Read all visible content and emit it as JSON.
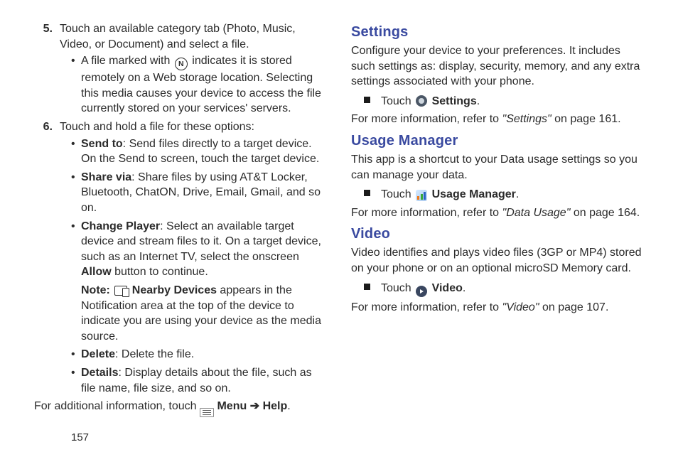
{
  "left": {
    "step5_num": "5.",
    "step5": "Touch an available category tab (Photo, Music, Video, or Document) and select a file.",
    "step5_sub_pre": "A file marked with ",
    "step5_sub_post": " indicates it is stored remotely on a Web storage location. Selecting this media causes your device to access the file currently stored on your services' servers.",
    "n_letter": "N",
    "step6_num": "6.",
    "step6": "Touch and hold a file for these options:",
    "sendto_b": "Send to",
    "sendto_t": ": Send files directly to a target device. On the Send to screen, touch the target device.",
    "share_b": "Share via",
    "share_t": ": Share files by using AT&T Locker, Bluetooth, ChatON, Drive, Email, Gmail, and so on.",
    "change_b": "Change Player",
    "change_t1": ": Select an available target device and stream files to it. On a target device, such as an Internet TV, select the onscreen ",
    "allow": "Allow",
    "change_t2": " button to continue.",
    "note_b": "Note:",
    "nearby_b": "Nearby Devices",
    "note_t": " appears in the Notification area at the top of the device to indicate you are using your device as the media source.",
    "delete_b": "Delete",
    "delete_t": ": Delete the file.",
    "details_b": "Details",
    "details_t": ": Display details about the file, such as file name, file size, and so on.",
    "footer_pre": "For additional information, touch ",
    "menu_b": "Menu",
    "arrow": "➔",
    "help_b": "Help",
    "period": "."
  },
  "right": {
    "settings_h": "Settings",
    "settings_p": "Configure your device to your preferences. It includes such settings as: display, security, memory, and any extra settings associated with your phone.",
    "touch": "Touch ",
    "settings_b": "Settings",
    "settings_ref_pre": "For more information, refer to ",
    "settings_ref_i": "\"Settings\"",
    "settings_ref_post": "  on page 161.",
    "usage_h": "Usage Manager",
    "usage_p": "This app is a shortcut to your Data usage settings so you can manage your data.",
    "usage_b": "Usage Manager",
    "usage_ref_pre": "For more information, refer to ",
    "usage_ref_i": "\"Data Usage\"",
    "usage_ref_post": "  on page 164.",
    "video_h": "Video",
    "video_p": "Video identifies and plays video files (3GP or MP4) stored on your phone or on an optional microSD Memory card.",
    "video_b": "Video",
    "video_ref_pre": "For more information, refer to ",
    "video_ref_i": "\"Video\"",
    "video_ref_post": "  on page 107."
  },
  "page": "157"
}
